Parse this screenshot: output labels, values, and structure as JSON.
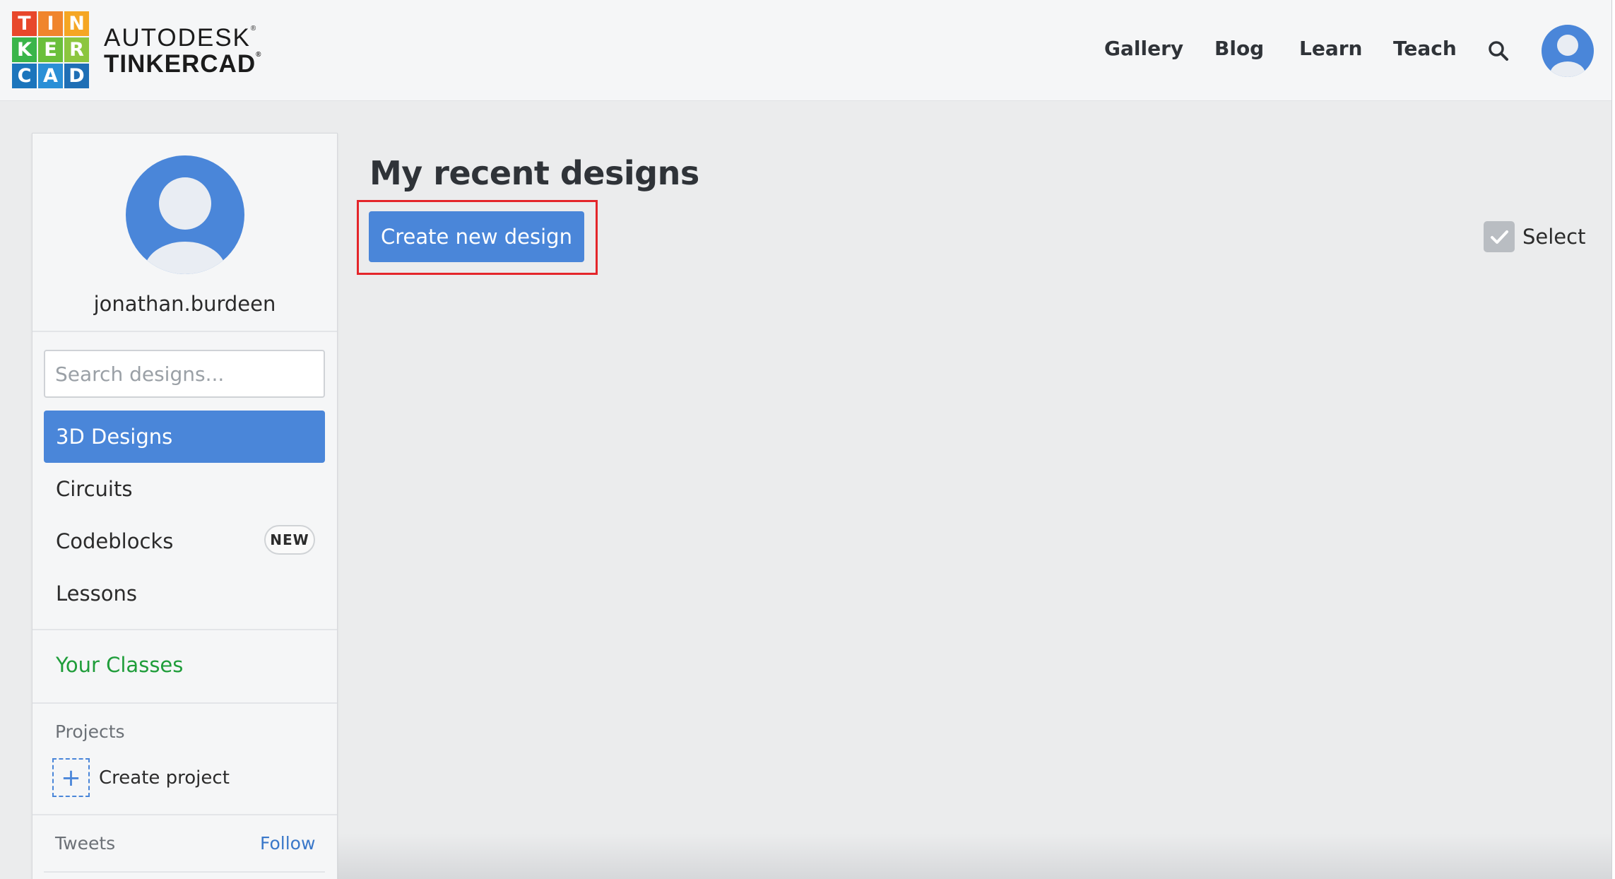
{
  "logo": {
    "tiles": [
      {
        "letter": "T",
        "color": "#e8472b"
      },
      {
        "letter": "I",
        "color": "#f0852d"
      },
      {
        "letter": "N",
        "color": "#f5a623"
      },
      {
        "letter": "K",
        "color": "#3ab54a"
      },
      {
        "letter": "E",
        "color": "#6abf3b"
      },
      {
        "letter": "R",
        "color": "#8cc63f"
      },
      {
        "letter": "C",
        "color": "#1b75bc"
      },
      {
        "letter": "A",
        "color": "#2a8fd6"
      },
      {
        "letter": "D",
        "color": "#1f6fb5"
      }
    ],
    "wordmark_line1": "AUTODESK",
    "wordmark_line2": "TINKERCAD",
    "trademark": "®"
  },
  "header": {
    "nav": [
      "Gallery",
      "Blog",
      "Learn",
      "Teach"
    ],
    "search_icon": "search-icon",
    "avatar_icon": "user-avatar-icon"
  },
  "sidebar": {
    "username": "jonathan.burdeen",
    "search_placeholder": "Search designs...",
    "items": [
      {
        "label": "3D Designs",
        "active": true
      },
      {
        "label": "Circuits",
        "active": false
      },
      {
        "label": "Codeblocks",
        "active": false,
        "badge": "NEW"
      },
      {
        "label": "Lessons",
        "active": false
      }
    ],
    "your_classes": "Your Classes",
    "projects_label": "Projects",
    "create_project": "Create project",
    "create_project_icon": "+",
    "tweets_label": "Tweets",
    "follow_label": "Follow"
  },
  "main": {
    "title": "My recent designs",
    "create_button": "Create new design",
    "select_label": "Select"
  },
  "colors": {
    "accent": "#4a86d9",
    "classes_green": "#1f9d3a",
    "highlight_red": "#e4262b",
    "background": "#ebeced"
  }
}
